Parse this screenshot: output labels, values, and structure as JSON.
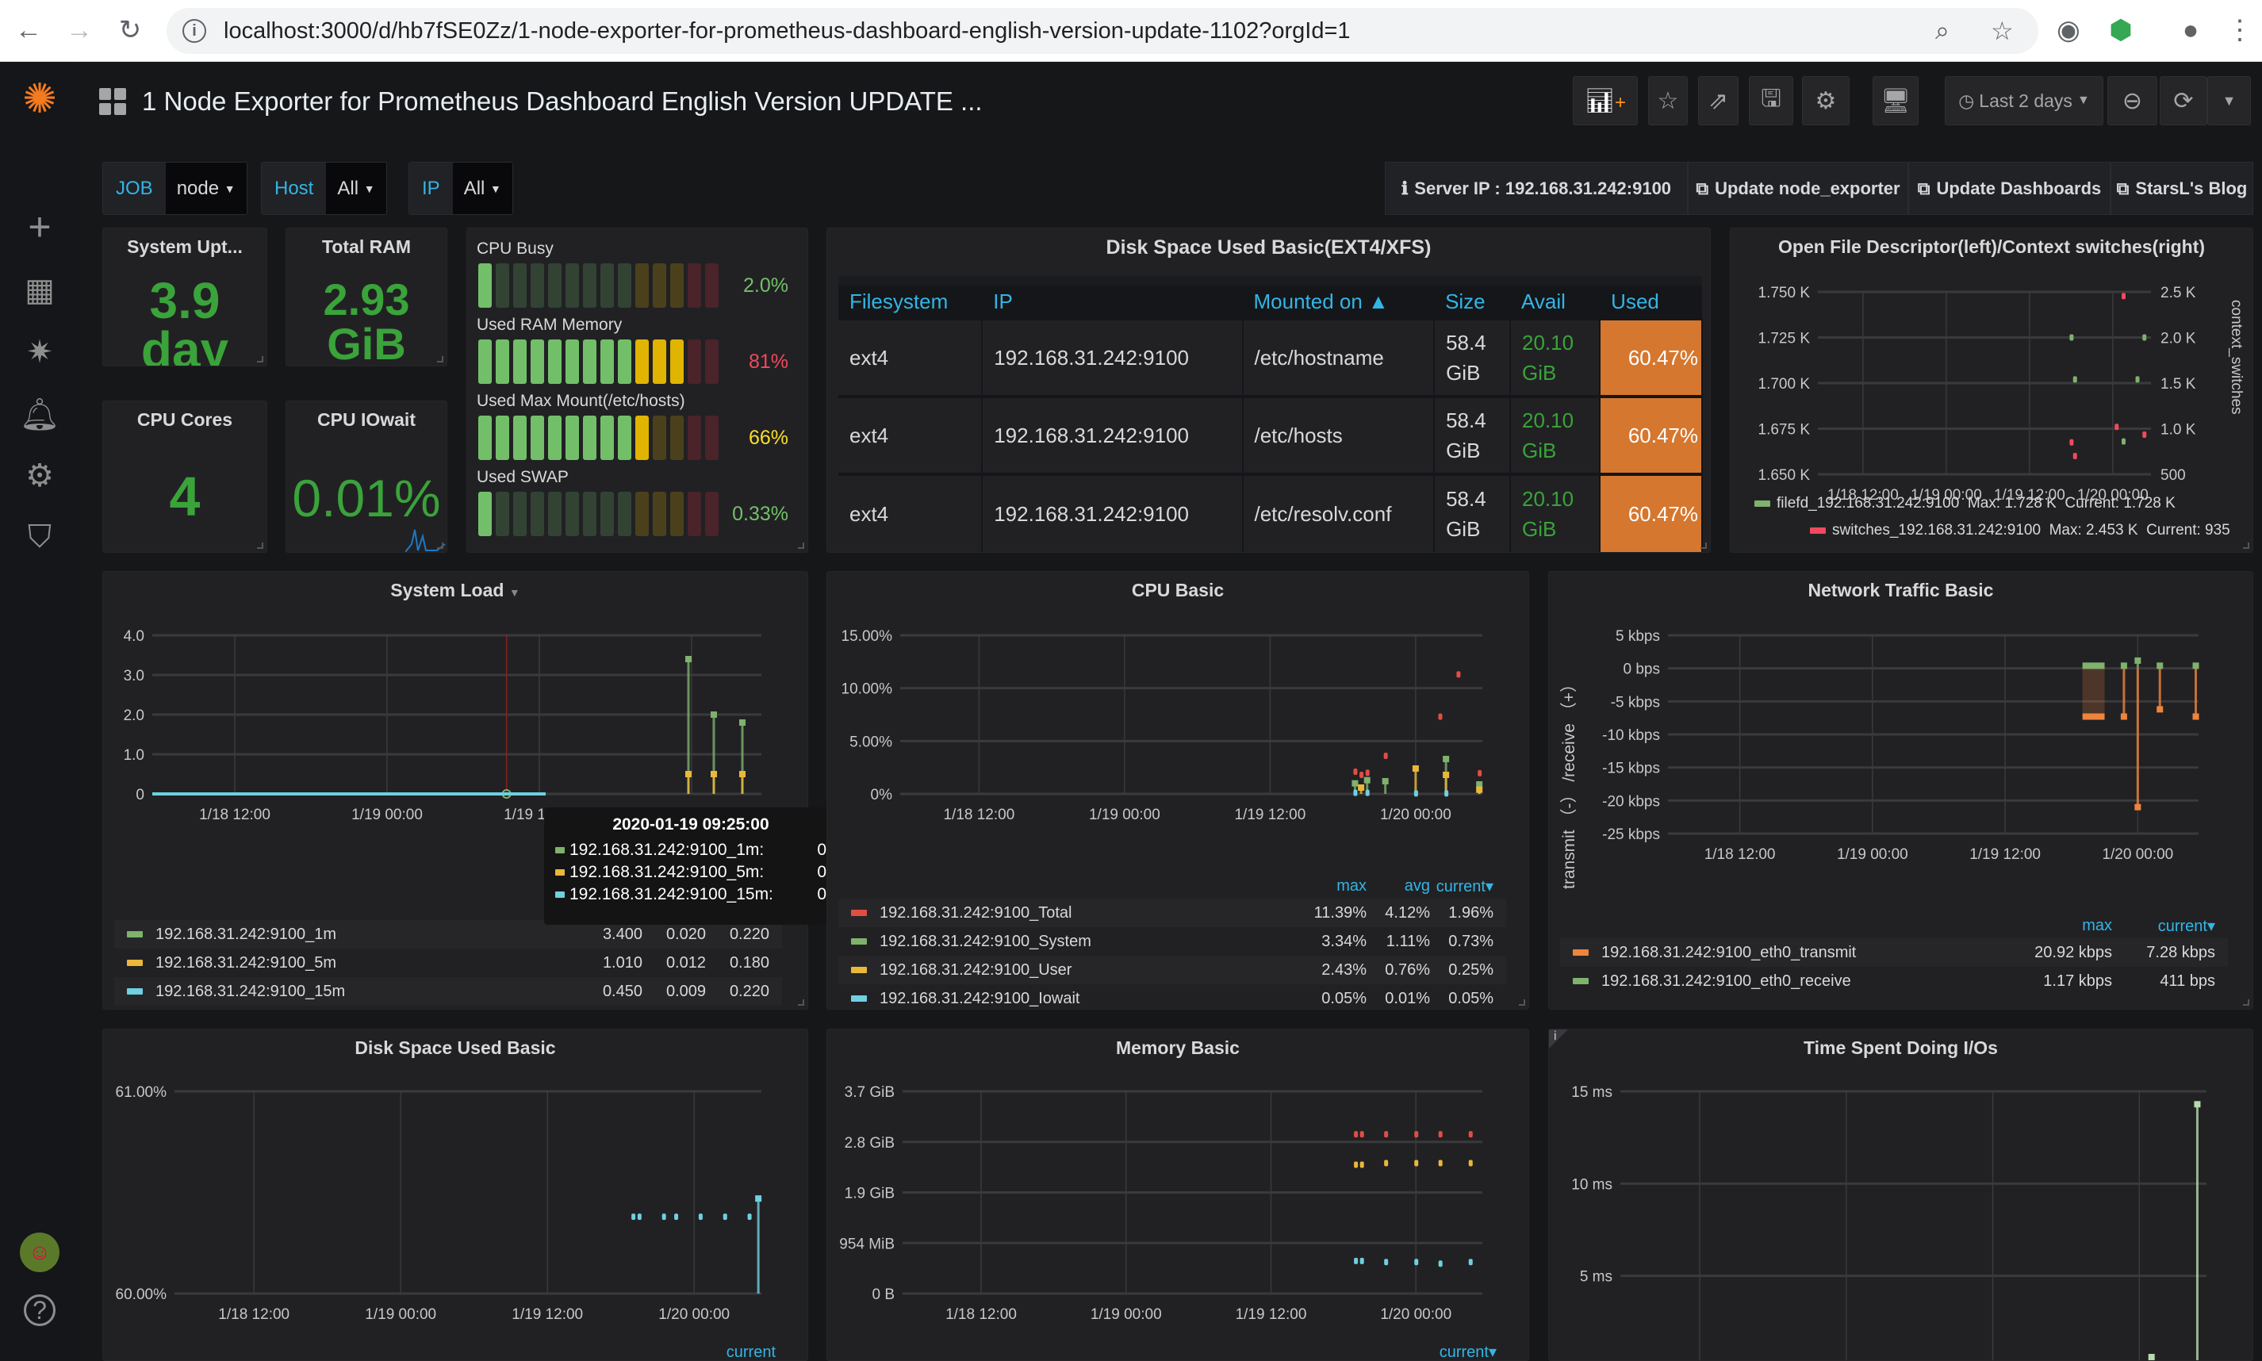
{
  "browser": {
    "url": "localhost:3000/d/hb7fSE0Zz/1-node-exporter-for-prometheus-dashboard-english-version-update-1102?orgId=1"
  },
  "header": {
    "title": "1 Node Exporter for Prometheus Dashboard English Version UPDATE ...",
    "time_picker": "Last 2 days"
  },
  "variables": [
    {
      "label": "JOB",
      "value": "node"
    },
    {
      "label": "Host",
      "value": "All"
    },
    {
      "label": "IP",
      "value": "All"
    }
  ],
  "links": {
    "server_ip": "Server IP : 192.168.31.242:9100",
    "update_exporter": "Update node_exporter",
    "update_dashboards": "Update Dashboards",
    "blog": "StarsL's Blog"
  },
  "stats": {
    "uptime": {
      "title": "System Upt...",
      "value": "3.9",
      "unit": "day"
    },
    "ram": {
      "title": "Total RAM",
      "value": "2.93",
      "unit": "GiB"
    },
    "cores": {
      "title": "CPU Cores",
      "value": "4"
    },
    "iowait": {
      "title": "CPU IOwait",
      "value": "0.01%"
    }
  },
  "bargauge": [
    {
      "label": "CPU Busy",
      "value": "2.0%",
      "percent": 2.0,
      "color": "#73bf69"
    },
    {
      "label": "Used RAM Memory",
      "value": "81%",
      "percent": 81,
      "color": "#f2495c"
    },
    {
      "label": "Used Max Mount(/etc/hosts)",
      "value": "66%",
      "percent": 66,
      "color": "#fade2a"
    },
    {
      "label": "Used SWAP",
      "value": "0.33%",
      "percent": 0.33,
      "color": "#73bf69"
    }
  ],
  "disk_table": {
    "title": "Disk Space Used Basic(EXT4/XFS)",
    "columns": [
      "Filesystem",
      "IP",
      "Mounted on ▲",
      "Size",
      "Avail",
      "Used"
    ],
    "rows": [
      [
        "ext4",
        "192.168.31.242:9100",
        "/etc/hostname",
        "58.4 GiB",
        "20.10 GiB",
        "60.47%"
      ],
      [
        "ext4",
        "192.168.31.242:9100",
        "/etc/hosts",
        "58.4 GiB",
        "20.10 GiB",
        "60.47%"
      ],
      [
        "ext4",
        "192.168.31.242:9100",
        "/etc/resolv.conf",
        "58.4 GiB",
        "20.10 GiB",
        "60.47%"
      ]
    ]
  },
  "colors": {
    "green": "#7eb26d",
    "yellow": "#eab839",
    "cyan": "#6ed0e0",
    "red": "#e24d42",
    "orange": "#ef843c",
    "accent": "#33b5e5"
  },
  "graphs": {
    "openfile": {
      "title": "Open File Descriptor(left)/Context switches(right)",
      "y_range": [
        1650,
        1750
      ],
      "y_ticks": [
        {
          "v": 1650,
          "l": "1.650 K"
        },
        {
          "v": 1675,
          "l": "1.675 K"
        },
        {
          "v": 1700,
          "l": "1.700 K"
        },
        {
          "v": 1725,
          "l": "1.725 K"
        },
        {
          "v": 1750,
          "l": "1.750 K"
        }
      ],
      "y_right_range": [
        500,
        2500
      ],
      "y_right_ticks": [
        {
          "v": 500,
          "l": "500"
        },
        {
          "v": 1000,
          "l": "1.0 K"
        },
        {
          "v": 1500,
          "l": "1.5 K"
        },
        {
          "v": 2000,
          "l": "2.0 K"
        },
        {
          "v": 2500,
          "l": "2.5 K"
        }
      ],
      "y_right_label": "context_switches",
      "x_ticks": [
        {
          "t": "2020-01-18 12:00",
          "l": "1/18 12:00"
        },
        {
          "t": "2020-01-19 00:00",
          "l": "1/19 00:00"
        },
        {
          "t": "2020-01-19 12:00",
          "l": "1/19 12:00"
        },
        {
          "t": "2020-01-20 00:00",
          "l": "1/20 00:00"
        }
      ],
      "series": [
        {
          "name": "filefd_192.168.31.242:9100",
          "max": "Max: 1.728 K",
          "current": "Current: 1.728 K",
          "color": "#7eb26d",
          "type": "dots",
          "points": [
            [
              "2020-01-19 18:00",
              1725
            ],
            [
              "2020-01-20 04:30",
              1725
            ],
            [
              "2020-01-19 18:30",
              1702
            ],
            [
              "2020-01-20 03:30",
              1702
            ],
            [
              "2020-01-20 01:30",
              1668
            ]
          ]
        },
        {
          "name": "switches_192.168.31.242:9100",
          "max": "Max: 2.453 K",
          "current": "Current: 935",
          "color": "#f2495c",
          "type": "dots",
          "axis": "right",
          "points": [
            [
              "2020-01-20 01:30",
              2453
            ],
            [
              "2020-01-20 00:30",
              1020
            ],
            [
              "2020-01-20 04:30",
              935
            ],
            [
              "2020-01-19 18:00",
              850
            ],
            [
              "2020-01-19 18:30",
              700
            ]
          ]
        }
      ]
    },
    "sysload": {
      "title": "System Load",
      "y_range": [
        0,
        4
      ],
      "y_ticks": [
        {
          "v": 0,
          "l": "0"
        },
        {
          "v": 1,
          "l": "1.0"
        },
        {
          "v": 2,
          "l": "2.0"
        },
        {
          "v": 3,
          "l": "3.0"
        },
        {
          "v": 4,
          "l": "4.0"
        }
      ],
      "x_ticks": [
        {
          "t": "2020-01-18 12:00",
          "l": "1/18 12:00"
        },
        {
          "t": "2020-01-19 00:00",
          "l": "1/19 00:00"
        },
        {
          "t": "2020-01-19 12:00",
          "l": "1/19 12:00"
        },
        {
          "t": "2020-01-20 00:00",
          "l": "1/20 00:00"
        }
      ],
      "crosshair": "2020-01-19 09:25",
      "tooltip": {
        "time": "2020-01-19 09:25:00",
        "rows": [
          {
            "name": "192.168.31.242:9100_1m:",
            "value": "0",
            "color": "#7eb26d"
          },
          {
            "name": "192.168.31.242:9100_5m:",
            "value": "0",
            "color": "#eab839"
          },
          {
            "name": "192.168.31.242:9100_15m:",
            "value": "0",
            "color": "#6ed0e0"
          }
        ]
      },
      "series": [
        {
          "name": "192.168.31.242:9100_1m",
          "max": "3.400",
          "avg": "0.020",
          "current": "0.220",
          "color": "#7eb26d",
          "type": "bars",
          "points": [
            [
              "2020-01-19 23:45",
              3.4
            ],
            [
              "2020-01-20 01:45",
              2.0
            ],
            [
              "2020-01-20 04:00",
              1.8
            ]
          ]
        },
        {
          "name": "192.168.31.242:9100_5m",
          "max": "1.010",
          "avg": "0.012",
          "current": "0.180",
          "color": "#eab839",
          "type": "bars",
          "points": [
            [
              "2020-01-19 23:45",
              0.5
            ],
            [
              "2020-01-20 01:45",
              0.5
            ],
            [
              "2020-01-20 04:00",
              0.5
            ]
          ]
        },
        {
          "name": "192.168.31.242:9100_15m",
          "max": "0.450",
          "avg": "0.009",
          "current": "0.220",
          "color": "#6ed0e0",
          "type": "line",
          "points": [
            [
              "2020-01-18 05:30",
              0
            ],
            [
              "2020-01-19 12:30",
              0
            ]
          ]
        }
      ]
    },
    "cpu": {
      "title": "CPU Basic",
      "y_range": [
        0,
        15
      ],
      "y_ticks": [
        {
          "v": 0,
          "l": "0%"
        },
        {
          "v": 5,
          "l": "5.00%"
        },
        {
          "v": 10,
          "l": "10.00%"
        },
        {
          "v": 15,
          "l": "15.00%"
        }
      ],
      "x_ticks": [
        {
          "t": "2020-01-18 12:00",
          "l": "1/18 12:00"
        },
        {
          "t": "2020-01-19 00:00",
          "l": "1/19 00:00"
        },
        {
          "t": "2020-01-19 12:00",
          "l": "1/19 12:00"
        },
        {
          "t": "2020-01-20 00:00",
          "l": "1/20 00:00"
        }
      ],
      "legend_headers": [
        "max",
        "avg",
        "current▾"
      ],
      "series": [
        {
          "name": "192.168.31.242:9100_Total",
          "max": "11.39%",
          "avg": "4.12%",
          "current": "1.96%",
          "color": "#e24d42",
          "type": "dots",
          "points": [
            [
              "2020-01-19 19:00",
              2.1
            ],
            [
              "2020-01-19 19:30",
              1.8
            ],
            [
              "2020-01-19 20:00",
              2.0
            ],
            [
              "2020-01-19 21:30",
              3.6
            ],
            [
              "2020-01-20 02:00",
              7.3
            ],
            [
              "2020-01-20 03:30",
              11.3
            ],
            [
              "2020-01-20 05:15",
              1.96
            ]
          ]
        },
        {
          "name": "192.168.31.242:9100_System",
          "max": "3.34%",
          "avg": "1.11%",
          "current": "0.73%",
          "color": "#7eb26d",
          "type": "bars",
          "points": [
            [
              "2020-01-19 19:00",
              1.0
            ],
            [
              "2020-01-19 20:00",
              1.3
            ],
            [
              "2020-01-19 21:30",
              1.2
            ],
            [
              "2020-01-20 02:30",
              3.3
            ],
            [
              "2020-01-20 05:15",
              0.9
            ]
          ]
        },
        {
          "name": "192.168.31.242:9100_User",
          "max": "2.43%",
          "avg": "0.76%",
          "current": "0.25%",
          "color": "#eab839",
          "type": "bars",
          "points": [
            [
              "2020-01-19 19:30",
              0.6
            ],
            [
              "2020-01-20 00:00",
              2.4
            ],
            [
              "2020-01-20 02:30",
              1.8
            ],
            [
              "2020-01-20 05:15",
              0.4
            ]
          ]
        },
        {
          "name": "192.168.31.242:9100_Iowait",
          "max": "0.05%",
          "avg": "0.01%",
          "current": "0.05%",
          "color": "#6ed0e0",
          "type": "dots",
          "points": [
            [
              "2020-01-19 19:00",
              0.1
            ],
            [
              "2020-01-19 20:00",
              0.1
            ],
            [
              "2020-01-20 00:00",
              0.05
            ],
            [
              "2020-01-20 02:30",
              0.05
            ]
          ]
        }
      ]
    },
    "network": {
      "title": "Network Traffic Basic",
      "y_label": "transmit （-） /receive （+）",
      "y_range": [
        -25,
        5
      ],
      "y_ticks": [
        {
          "v": 5,
          "l": "5 kbps"
        },
        {
          "v": 0,
          "l": "0 bps"
        },
        {
          "v": -5,
          "l": "-5 kbps"
        },
        {
          "v": -10,
          "l": "-10 kbps"
        },
        {
          "v": -15,
          "l": "-15 kbps"
        },
        {
          "v": -20,
          "l": "-20 kbps"
        },
        {
          "v": -25,
          "l": "-25 kbps"
        }
      ],
      "x_ticks": [
        {
          "t": "2020-01-18 12:00",
          "l": "1/18 12:00"
        },
        {
          "t": "2020-01-19 00:00",
          "l": "1/19 00:00"
        },
        {
          "t": "2020-01-19 12:00",
          "l": "1/19 12:00"
        },
        {
          "t": "2020-01-20 00:00",
          "l": "1/20 00:00"
        }
      ],
      "legend_headers": [
        "max",
        "current▾"
      ],
      "series": [
        {
          "name": "192.168.31.242:9100_eth0_transmit",
          "max": "20.92 kbps",
          "current": "7.28 kbps",
          "color": "#ef843c",
          "type": "bars",
          "points": [
            [
              "2020-01-19 19:00",
              -7.3,
              "2020-01-19 21:00"
            ],
            [
              "2020-01-19 22:45",
              -7.3
            ],
            [
              "2020-01-20 00:00",
              -21
            ],
            [
              "2020-01-20 02:00",
              -6.2
            ],
            [
              "2020-01-20 05:15",
              -7.3
            ]
          ]
        },
        {
          "name": "192.168.31.242:9100_eth0_receive",
          "max": "1.17 kbps",
          "current": "411 bps",
          "color": "#7eb26d",
          "type": "bars",
          "points": [
            [
              "2020-01-19 19:00",
              0.4,
              "2020-01-19 21:00"
            ],
            [
              "2020-01-19 22:45",
              0.4
            ],
            [
              "2020-01-20 00:00",
              1.17
            ],
            [
              "2020-01-20 02:00",
              0.4
            ],
            [
              "2020-01-20 05:15",
              0.4
            ]
          ]
        }
      ]
    },
    "diskused": {
      "title": "Disk Space Used Basic",
      "y_range": [
        60,
        61
      ],
      "y_ticks": [
        {
          "v": 60,
          "l": "60.00%"
        },
        {
          "v": 61,
          "l": "61.00%"
        }
      ],
      "x_ticks": [
        {
          "t": "2020-01-18 12:00",
          "l": "1/18 12:00"
        },
        {
          "t": "2020-01-19 00:00",
          "l": "1/19 00:00"
        },
        {
          "t": "2020-01-19 12:00",
          "l": "1/19 12:00"
        },
        {
          "t": "2020-01-20 00:00",
          "l": "1/20 00:00"
        }
      ],
      "legend_headers": [
        "current"
      ],
      "series": [
        {
          "color": "#6ed0e0",
          "type": "dots",
          "points": [
            [
              "2020-01-19 19:00",
              60.38
            ],
            [
              "2020-01-19 19:30",
              60.38
            ],
            [
              "2020-01-19 21:30",
              60.38
            ],
            [
              "2020-01-19 22:30",
              60.38
            ],
            [
              "2020-01-20 00:30",
              60.38
            ],
            [
              "2020-01-20 02:30",
              60.38
            ],
            [
              "2020-01-20 04:30",
              60.38
            ]
          ]
        },
        {
          "color": "#6ed0e0",
          "type": "bars",
          "points": [
            [
              "2020-01-20 05:15",
              60.47
            ]
          ]
        }
      ]
    },
    "memory": {
      "title": "Memory Basic",
      "y_range": [
        0,
        3.72
      ],
      "y_ticks": [
        {
          "v": 0,
          "l": "0 B"
        },
        {
          "v": 0.93,
          "l": "954 MiB"
        },
        {
          "v": 1.86,
          "l": "1.9 GiB"
        },
        {
          "v": 2.79,
          "l": "2.8 GiB"
        },
        {
          "v": 3.72,
          "l": "3.7 GiB"
        }
      ],
      "x_ticks": [
        {
          "t": "2020-01-18 12:00",
          "l": "1/18 12:00"
        },
        {
          "t": "2020-01-19 00:00",
          "l": "1/19 00:00"
        },
        {
          "t": "2020-01-19 12:00",
          "l": "1/19 12:00"
        },
        {
          "t": "2020-01-20 00:00",
          "l": "1/20 00:00"
        }
      ],
      "legend_headers": [
        "current▾"
      ],
      "series": [
        {
          "color": "#e24d42",
          "type": "dots",
          "points": [
            [
              "2020-01-19 19:00",
              2.93
            ],
            [
              "2020-01-19 19:30",
              2.93
            ],
            [
              "2020-01-19 21:30",
              2.93
            ],
            [
              "2020-01-20 00:00",
              2.93
            ],
            [
              "2020-01-20 02:00",
              2.93
            ],
            [
              "2020-01-20 04:30",
              2.93
            ]
          ]
        },
        {
          "color": "#eab839",
          "type": "dots",
          "points": [
            [
              "2020-01-19 19:00",
              2.37
            ],
            [
              "2020-01-19 19:30",
              2.37
            ],
            [
              "2020-01-19 21:30",
              2.4
            ],
            [
              "2020-01-20 00:00",
              2.4
            ],
            [
              "2020-01-20 02:00",
              2.4
            ],
            [
              "2020-01-20 04:30",
              2.4
            ]
          ]
        },
        {
          "color": "#6ed0e0",
          "type": "dots",
          "points": [
            [
              "2020-01-19 19:00",
              0.6
            ],
            [
              "2020-01-19 19:30",
              0.6
            ],
            [
              "2020-01-19 21:30",
              0.58
            ],
            [
              "2020-01-20 00:00",
              0.58
            ],
            [
              "2020-01-20 02:00",
              0.55
            ],
            [
              "2020-01-20 04:30",
              0.58
            ]
          ]
        }
      ]
    },
    "io": {
      "title": "Time Spent Doing I/Os",
      "y_range": [
        0,
        15
      ],
      "y_ticks": [
        {
          "v": 5,
          "l": "5 ms"
        },
        {
          "v": 10,
          "l": "10 ms"
        },
        {
          "v": 15,
          "l": "15 ms"
        }
      ],
      "x_ticks": [],
      "series": [
        {
          "color": "#b7dbab",
          "type": "bars",
          "points": [
            [
              "2020-01-20 04:45",
              14.3
            ],
            [
              "2020-01-20 01:00",
              0.6
            ]
          ]
        }
      ]
    }
  }
}
